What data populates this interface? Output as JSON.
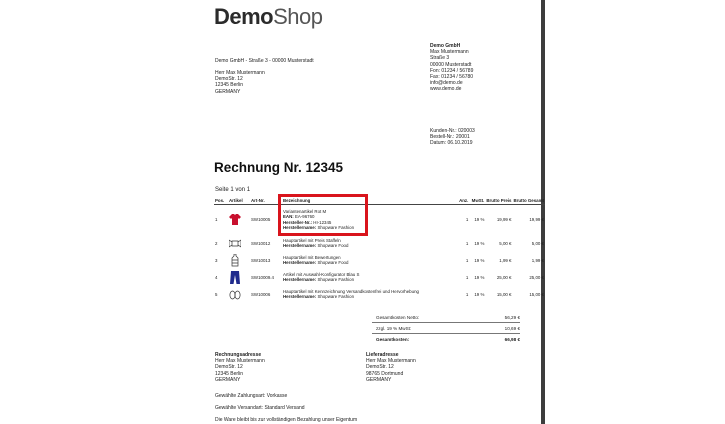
{
  "logo": {
    "demo": "Demo",
    "shop": "Shop"
  },
  "sender_line": "Demo GmbH - Straße 3 - 00000 Musterstadt",
  "recipient": [
    "Herr Max Mustermann",
    "DemoStr. 12",
    "12345 Berlin",
    "GERMANY"
  ],
  "company": {
    "name": "Demo GmbH",
    "lines": [
      "Max Mustermann",
      "Straße 3",
      "00000 Musterstadt",
      "Fon: 01234 / 56789",
      "Fax: 01234 / 56780",
      "info@demo.de",
      "www.demo.de"
    ]
  },
  "meta": [
    "Kunden-Nr.: 020003",
    "Bestell-Nr.: 20001",
    "Datum: 06.10.2019"
  ],
  "title": "Rechnung Nr. 12345",
  "page_label": "Seite 1 von 1",
  "table": {
    "headers": {
      "pos": "Pos.",
      "article": "Artikel",
      "artnr": "Art-Nr.",
      "desc": "Bezeichnung",
      "qty": "Anz.",
      "vat": "MwSt.",
      "unit": "Brutto Preis",
      "total": "Brutto Gesamt"
    },
    "rows": [
      {
        "pos": "1",
        "artnr": "SW10005",
        "desc1": "Variantenartikel Rot M",
        "desc2_label": "EAN:",
        "desc2": "EA-96760",
        "desc3_label": "Hersteller-Nr.:",
        "desc3": "HI-12345",
        "desc4_label": "Herstellername:",
        "desc4": "Shopware Fashion",
        "qty": "1",
        "vat": "19 %",
        "unit": "19,99 €",
        "total": "19,99 €",
        "icon": "red-sweater-icon"
      },
      {
        "pos": "2",
        "artnr": "SW10012",
        "desc1": "Hauptartikel mit Preis Staffeln",
        "desc2_label": "Herstellername:",
        "desc2": "Shopware Food",
        "qty": "1",
        "vat": "19 %",
        "unit": "5,00 €",
        "total": "5,00 €",
        "icon": "candy-icon"
      },
      {
        "pos": "3",
        "artnr": "SW10013",
        "desc1": "Hauptartikel mit Bewertungen",
        "desc2_label": "Herstellername:",
        "desc2": "Shopware Food",
        "qty": "1",
        "vat": "19 %",
        "unit": "1,99 €",
        "total": "1,99 €",
        "icon": "bottle-icon"
      },
      {
        "pos": "4",
        "artnr": "SW10009.4",
        "desc1": "Artikel mit Auswahl-Konfigurator Blau S",
        "desc2_label": "Herstellername:",
        "desc2": "Shopware Fashion",
        "qty": "1",
        "vat": "19 %",
        "unit": "25,00 €",
        "total": "25,00 €",
        "icon": "blue-pants-icon"
      },
      {
        "pos": "5",
        "artnr": "SW10006",
        "desc1": "Hauptartikel mit Kennzeichnung Versandkostenfrei und Hervorhebung",
        "desc2_label": "Herstellername:",
        "desc2": "Shopware Fashion",
        "qty": "1",
        "vat": "19 %",
        "unit": "15,00 €",
        "total": "15,00 €",
        "icon": "flip-flops-icon"
      }
    ]
  },
  "totals": [
    {
      "label": "Gesamtkosten Netto:",
      "value": "56,29 €"
    },
    {
      "label": "zzgl. 19 % MwSt:",
      "value": "10,69 €"
    },
    {
      "label": "Gesamtkosten:",
      "value": "66,98 €"
    }
  ],
  "billing": {
    "heading": "Rechnungsadresse",
    "lines": [
      "Herr Max Mustermann",
      "DemoStr. 12",
      "12345 Berlin",
      "GERMANY"
    ]
  },
  "shipping": {
    "heading": "Lieferadresse",
    "lines": [
      "Herr Max Mustermann",
      "DemoStr. 12",
      "98765 Dortmund",
      "GERMANY"
    ]
  },
  "footer": [
    "Gewählte Zahlungsart: Vorkasse",
    "Gewählte Versandart: Standard Versand",
    "Die Ware bleibt bis zur vollständigen Bezahlung unser Eigentum"
  ],
  "colors": {
    "highlight": "#d9141c",
    "sweater": "#c8102e",
    "pants": "#1f2a8c"
  }
}
